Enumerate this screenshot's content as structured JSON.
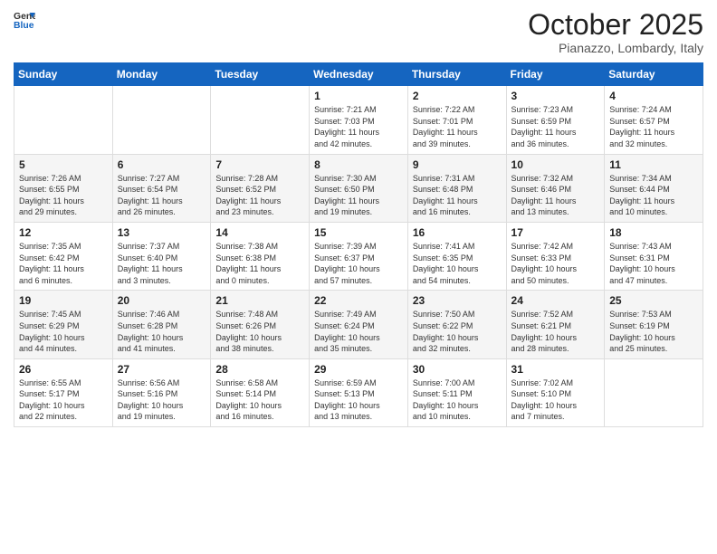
{
  "header": {
    "logo_general": "General",
    "logo_blue": "Blue",
    "month": "October 2025",
    "location": "Pianazzo, Lombardy, Italy"
  },
  "weekdays": [
    "Sunday",
    "Monday",
    "Tuesday",
    "Wednesday",
    "Thursday",
    "Friday",
    "Saturday"
  ],
  "weeks": [
    [
      {
        "day": "",
        "info": ""
      },
      {
        "day": "",
        "info": ""
      },
      {
        "day": "",
        "info": ""
      },
      {
        "day": "1",
        "info": "Sunrise: 7:21 AM\nSunset: 7:03 PM\nDaylight: 11 hours\nand 42 minutes."
      },
      {
        "day": "2",
        "info": "Sunrise: 7:22 AM\nSunset: 7:01 PM\nDaylight: 11 hours\nand 39 minutes."
      },
      {
        "day": "3",
        "info": "Sunrise: 7:23 AM\nSunset: 6:59 PM\nDaylight: 11 hours\nand 36 minutes."
      },
      {
        "day": "4",
        "info": "Sunrise: 7:24 AM\nSunset: 6:57 PM\nDaylight: 11 hours\nand 32 minutes."
      }
    ],
    [
      {
        "day": "5",
        "info": "Sunrise: 7:26 AM\nSunset: 6:55 PM\nDaylight: 11 hours\nand 29 minutes."
      },
      {
        "day": "6",
        "info": "Sunrise: 7:27 AM\nSunset: 6:54 PM\nDaylight: 11 hours\nand 26 minutes."
      },
      {
        "day": "7",
        "info": "Sunrise: 7:28 AM\nSunset: 6:52 PM\nDaylight: 11 hours\nand 23 minutes."
      },
      {
        "day": "8",
        "info": "Sunrise: 7:30 AM\nSunset: 6:50 PM\nDaylight: 11 hours\nand 19 minutes."
      },
      {
        "day": "9",
        "info": "Sunrise: 7:31 AM\nSunset: 6:48 PM\nDaylight: 11 hours\nand 16 minutes."
      },
      {
        "day": "10",
        "info": "Sunrise: 7:32 AM\nSunset: 6:46 PM\nDaylight: 11 hours\nand 13 minutes."
      },
      {
        "day": "11",
        "info": "Sunrise: 7:34 AM\nSunset: 6:44 PM\nDaylight: 11 hours\nand 10 minutes."
      }
    ],
    [
      {
        "day": "12",
        "info": "Sunrise: 7:35 AM\nSunset: 6:42 PM\nDaylight: 11 hours\nand 6 minutes."
      },
      {
        "day": "13",
        "info": "Sunrise: 7:37 AM\nSunset: 6:40 PM\nDaylight: 11 hours\nand 3 minutes."
      },
      {
        "day": "14",
        "info": "Sunrise: 7:38 AM\nSunset: 6:38 PM\nDaylight: 11 hours\nand 0 minutes."
      },
      {
        "day": "15",
        "info": "Sunrise: 7:39 AM\nSunset: 6:37 PM\nDaylight: 10 hours\nand 57 minutes."
      },
      {
        "day": "16",
        "info": "Sunrise: 7:41 AM\nSunset: 6:35 PM\nDaylight: 10 hours\nand 54 minutes."
      },
      {
        "day": "17",
        "info": "Sunrise: 7:42 AM\nSunset: 6:33 PM\nDaylight: 10 hours\nand 50 minutes."
      },
      {
        "day": "18",
        "info": "Sunrise: 7:43 AM\nSunset: 6:31 PM\nDaylight: 10 hours\nand 47 minutes."
      }
    ],
    [
      {
        "day": "19",
        "info": "Sunrise: 7:45 AM\nSunset: 6:29 PM\nDaylight: 10 hours\nand 44 minutes."
      },
      {
        "day": "20",
        "info": "Sunrise: 7:46 AM\nSunset: 6:28 PM\nDaylight: 10 hours\nand 41 minutes."
      },
      {
        "day": "21",
        "info": "Sunrise: 7:48 AM\nSunset: 6:26 PM\nDaylight: 10 hours\nand 38 minutes."
      },
      {
        "day": "22",
        "info": "Sunrise: 7:49 AM\nSunset: 6:24 PM\nDaylight: 10 hours\nand 35 minutes."
      },
      {
        "day": "23",
        "info": "Sunrise: 7:50 AM\nSunset: 6:22 PM\nDaylight: 10 hours\nand 32 minutes."
      },
      {
        "day": "24",
        "info": "Sunrise: 7:52 AM\nSunset: 6:21 PM\nDaylight: 10 hours\nand 28 minutes."
      },
      {
        "day": "25",
        "info": "Sunrise: 7:53 AM\nSunset: 6:19 PM\nDaylight: 10 hours\nand 25 minutes."
      }
    ],
    [
      {
        "day": "26",
        "info": "Sunrise: 6:55 AM\nSunset: 5:17 PM\nDaylight: 10 hours\nand 22 minutes."
      },
      {
        "day": "27",
        "info": "Sunrise: 6:56 AM\nSunset: 5:16 PM\nDaylight: 10 hours\nand 19 minutes."
      },
      {
        "day": "28",
        "info": "Sunrise: 6:58 AM\nSunset: 5:14 PM\nDaylight: 10 hours\nand 16 minutes."
      },
      {
        "day": "29",
        "info": "Sunrise: 6:59 AM\nSunset: 5:13 PM\nDaylight: 10 hours\nand 13 minutes."
      },
      {
        "day": "30",
        "info": "Sunrise: 7:00 AM\nSunset: 5:11 PM\nDaylight: 10 hours\nand 10 minutes."
      },
      {
        "day": "31",
        "info": "Sunrise: 7:02 AM\nSunset: 5:10 PM\nDaylight: 10 hours\nand 7 minutes."
      },
      {
        "day": "",
        "info": ""
      }
    ]
  ]
}
